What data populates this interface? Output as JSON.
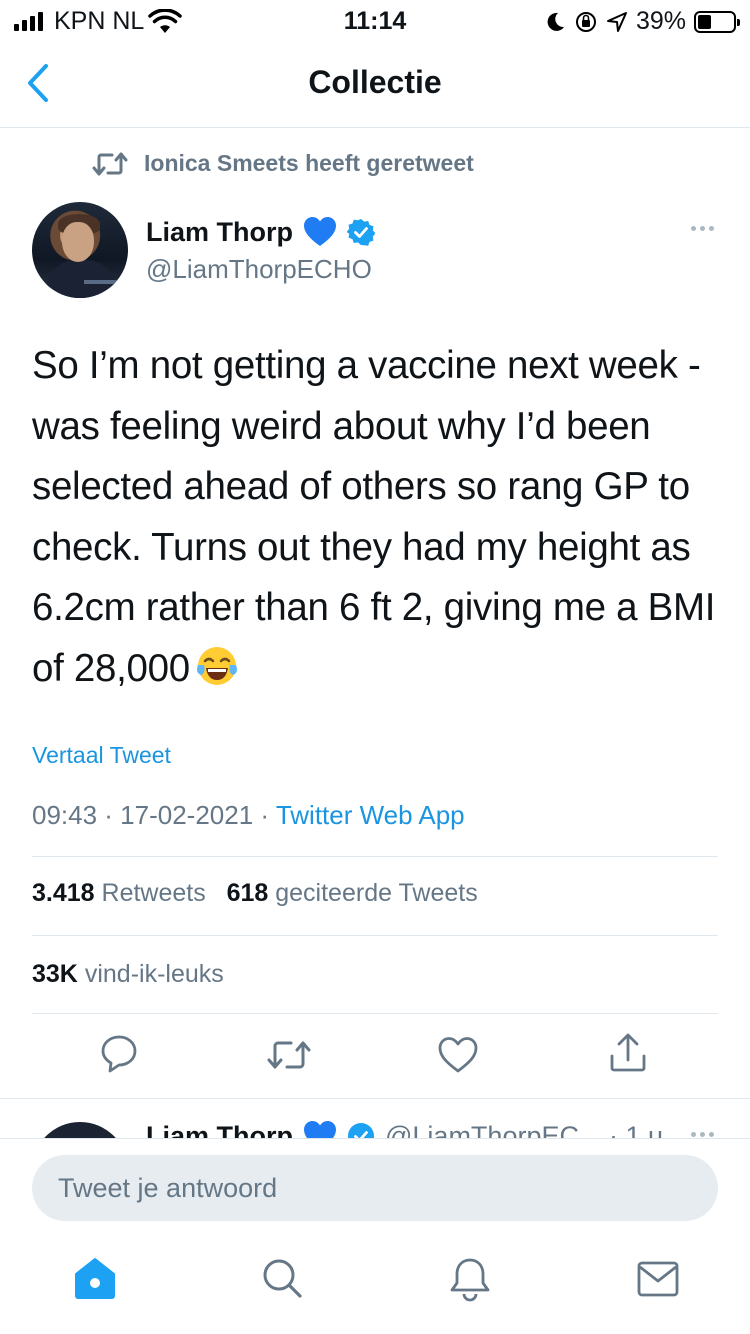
{
  "status": {
    "carrier": "KPN NL",
    "time": "11:14",
    "battery": "39%",
    "battery_level": 0.39
  },
  "nav": {
    "title": "Collectie"
  },
  "tweet": {
    "retweeted_by": "Ionica Smeets heeft geretweet",
    "author_name": "Liam Thorp",
    "author_handle": "@LiamThorpECHO",
    "text": "So I’m not getting a vaccine next week - was feeling weird about why I’d been selected ahead of others so rang GP to check. Turns out they had my height as 6.2cm rather than 6 ft 2, giving me a BMI of 28,000",
    "translate_label": "Vertaal Tweet",
    "timestamp": "09:43 · 17-02-2021 · ",
    "source": "Twitter Web App",
    "retweets_count": "3.418",
    "retweets_label": "Retweets",
    "quotes_count": "618",
    "quotes_label": "geciteerde Tweets",
    "likes_count": "33K",
    "likes_label": "vind-ik-leuks"
  },
  "reply_preview": {
    "author_name": "Liam Thorp",
    "handle_time": "@LiamThorpEC... · 1 u"
  },
  "composer": {
    "placeholder": "Tweet je antwoord"
  },
  "colors": {
    "accent": "#1DA1F2",
    "verified": "#1DA1F2",
    "heart": "#1f7cf2",
    "secondary_text": "#657786"
  }
}
